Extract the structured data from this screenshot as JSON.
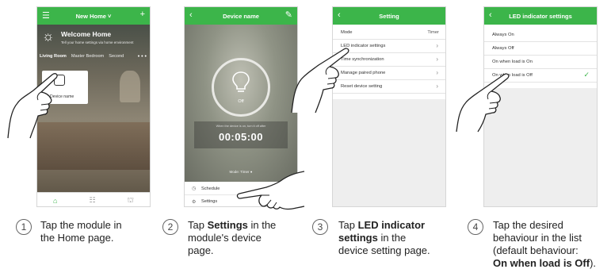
{
  "screen1": {
    "title": "New Home",
    "welcome": "Welcome Home",
    "welcome_sub": "Tell your home settings via home environment",
    "rooms": [
      "Living Room",
      "Master Bedroom",
      "Second"
    ],
    "more": "• • •",
    "device_label": "Device name",
    "nav_icons": [
      "home-icon",
      "grid-icon",
      "scene-icon"
    ]
  },
  "screen2": {
    "title": "Device name",
    "status": "Off",
    "timer_caption": "When the device is on, turn it off after",
    "timer_value": "00:05:00",
    "mode_line": "Mode: Timer",
    "menu": [
      "Schedule",
      "Settings"
    ]
  },
  "screen3": {
    "title": "Setting",
    "rows": [
      {
        "label": "Mode",
        "value": "Timer"
      },
      {
        "label": "LED indicator settings"
      },
      {
        "label": "Time synchronization"
      },
      {
        "label": "Manage paired phone"
      },
      {
        "label": "Reset device setting"
      }
    ]
  },
  "screen4": {
    "title": "LED indicator settings",
    "options": [
      "Always On",
      "Always Off",
      "On when load is On",
      "On when load is Off"
    ],
    "selected_index": 3
  },
  "steps": [
    {
      "number": "1",
      "line1": "Tap the module in",
      "line2": "the Home page."
    },
    {
      "number": "2",
      "pre": "Tap ",
      "bold": "Settings",
      "post": " in the",
      "line2": "module's device",
      "line3": "page."
    },
    {
      "number": "3",
      "pre": "Tap ",
      "bold": "LED indicator",
      "line2_bold": "settings",
      "line2_post": " in the",
      "line3": "device setting page."
    },
    {
      "number": "4",
      "line1": "Tap the desired",
      "line2": "behaviour in the list",
      "line3": "(default behaviour:",
      "line4_bold": "On when load is Off",
      "line4_post": ")."
    }
  ],
  "colors": {
    "accent": "#3cb54a",
    "divider": "#e3e3e3"
  }
}
